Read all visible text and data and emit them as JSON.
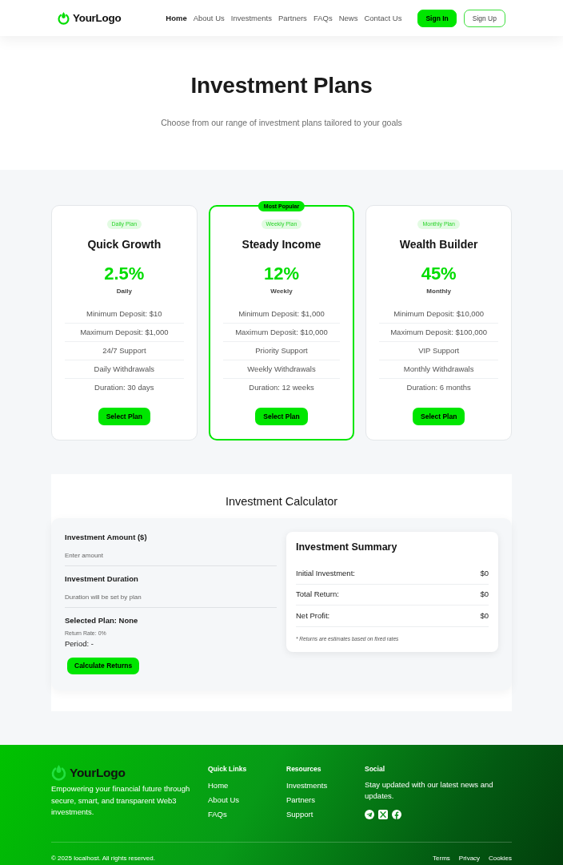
{
  "navbar": {
    "logo": "YourLogo",
    "links": [
      {
        "label": "Home",
        "selected": true
      },
      {
        "label": "About Us",
        "selected": false
      },
      {
        "label": "Investments",
        "selected": false
      },
      {
        "label": "Partners",
        "selected": false
      },
      {
        "label": "FAQs",
        "selected": false
      },
      {
        "label": "News",
        "selected": false
      },
      {
        "label": "Contact Us",
        "selected": false
      }
    ],
    "buttons": [
      {
        "label": "Sign In",
        "kind": "solid"
      },
      {
        "label": "Sign Up",
        "kind": "outline"
      }
    ]
  },
  "hero": {
    "title": "Investment Plans",
    "subtitle": "Choose from our range of investment plans tailored to your goals"
  },
  "plans": [
    {
      "tag": "Daily Plan",
      "title": "Quick Growth",
      "rate": "2.5%",
      "period": "Daily",
      "features": [
        "Minimum Deposit: $10",
        "Maximum Deposit: $1,000",
        "24/7 Support",
        "Daily Withdrawals",
        "Duration: 30 days"
      ],
      "button": "Select Plan",
      "featured": false
    },
    {
      "ribbon": "Most Popular",
      "tag": "Weekly Plan",
      "title": "Steady Income",
      "rate": "12%",
      "period": "Weekly",
      "features": [
        "Minimum Deposit: $1,000",
        "Maximum Deposit: $10,000",
        "Priority Support",
        "Weekly Withdrawals",
        "Duration: 12 weeks"
      ],
      "button": "Select Plan",
      "featured": true
    },
    {
      "tag": "Monthly Plan",
      "title": "Wealth Builder",
      "rate": "45%",
      "period": "Monthly",
      "features": [
        "Minimum Deposit: $10,000",
        "Maximum Deposit: $100,000",
        "VIP Support",
        "Monthly Withdrawals",
        "Duration: 6 months"
      ],
      "button": "Select Plan",
      "featured": false
    }
  ],
  "calculator": {
    "title": "Investment Calculator",
    "fields": [
      {
        "label": "Investment Amount ($)",
        "placeholder": "Enter amount"
      },
      {
        "label": "Investment Duration",
        "placeholder": "Duration will be set by plan"
      }
    ],
    "selected_plan": "Selected Plan: None",
    "return_rate": "Return Rate: 0%",
    "period": "Period: -",
    "button": "Calculate Returns",
    "summary": {
      "title": "Investment Summary",
      "rows": [
        {
          "label": "Initial Investment:",
          "value": "$0"
        },
        {
          "label": "Total Return:",
          "value": "$0"
        },
        {
          "label": "Net Profit:",
          "value": "$0"
        }
      ],
      "note": "* Returns are estimates based on fixed rates"
    }
  },
  "footer": {
    "logo": "YourLogo",
    "description": "Empowering your financial future through secure, smart, and transparent Web3 investments.",
    "columns": [
      {
        "title": "Quick Links",
        "links": [
          "Home",
          "About Us",
          "FAQs"
        ]
      },
      {
        "title": "Resources",
        "links": [
          "Investments",
          "Partners",
          "Support"
        ]
      }
    ],
    "social": {
      "title": "Social",
      "text": "Stay updated with our latest news and updates."
    },
    "copyright": "© 2025 localhost. All rights reserved.",
    "legal_links": [
      "Terms",
      "Privacy",
      "Cookies"
    ]
  }
}
